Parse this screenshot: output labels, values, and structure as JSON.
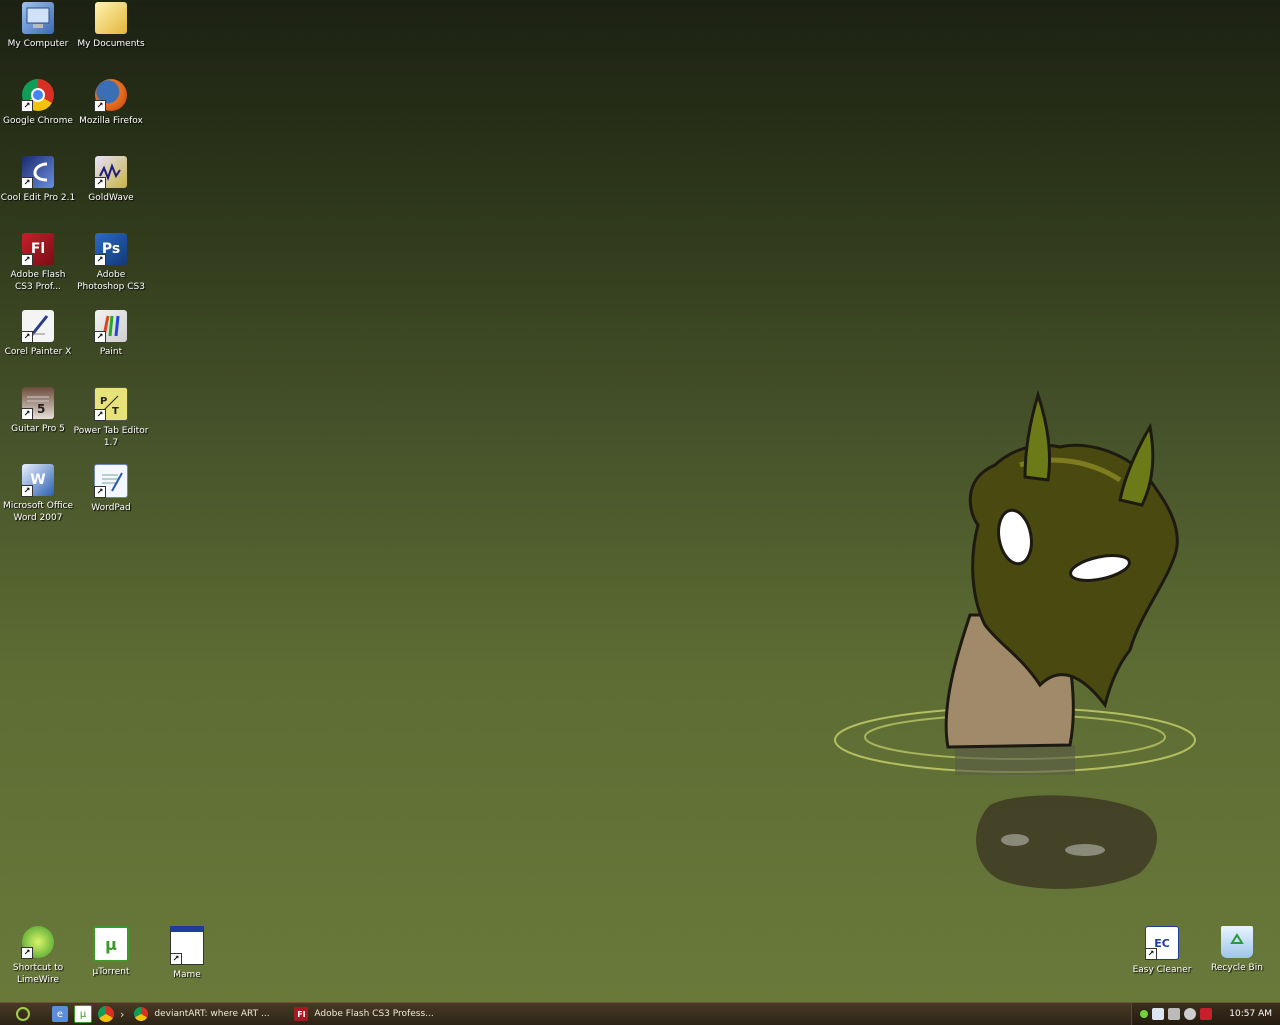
{
  "desktop": {
    "icons": [
      {
        "label": "My Computer"
      },
      {
        "label": "My Documents"
      },
      {
        "label": "Google Chrome"
      },
      {
        "label": "Mozilla Firefox"
      },
      {
        "label": "Cool Edit Pro 2.1"
      },
      {
        "label": "GoldWave"
      },
      {
        "label": "Adobe Flash\nCS3 Prof..."
      },
      {
        "label": "Adobe\nPhotoshop CS3"
      },
      {
        "label": "Corel Painter X"
      },
      {
        "label": "Paint"
      },
      {
        "label": "Guitar Pro 5"
      },
      {
        "label": "Power Tab Editor\n1.7"
      },
      {
        "label": "Microsoft Office\nWord 2007"
      },
      {
        "label": "WordPad"
      },
      {
        "label": "Shortcut to\nLimeWire"
      },
      {
        "label": "µTorrent"
      },
      {
        "label": "Mame"
      },
      {
        "label": "Easy Cleaner"
      },
      {
        "label": "Recycle Bin"
      }
    ],
    "icon_glyphs": {
      "flash": "Fl",
      "photoshop": "Ps",
      "word": "W",
      "utorrent": "µ",
      "easycleaner": "EC"
    }
  },
  "taskbar": {
    "chevron": "›",
    "tasks": [
      {
        "label": "deviantART: where ART ...",
        "icon": "chrome-icon"
      },
      {
        "label": "Adobe Flash CS3 Profess...",
        "icon": "flash-icon",
        "glyph": "Fl"
      }
    ],
    "clock": "10:57 AM"
  }
}
